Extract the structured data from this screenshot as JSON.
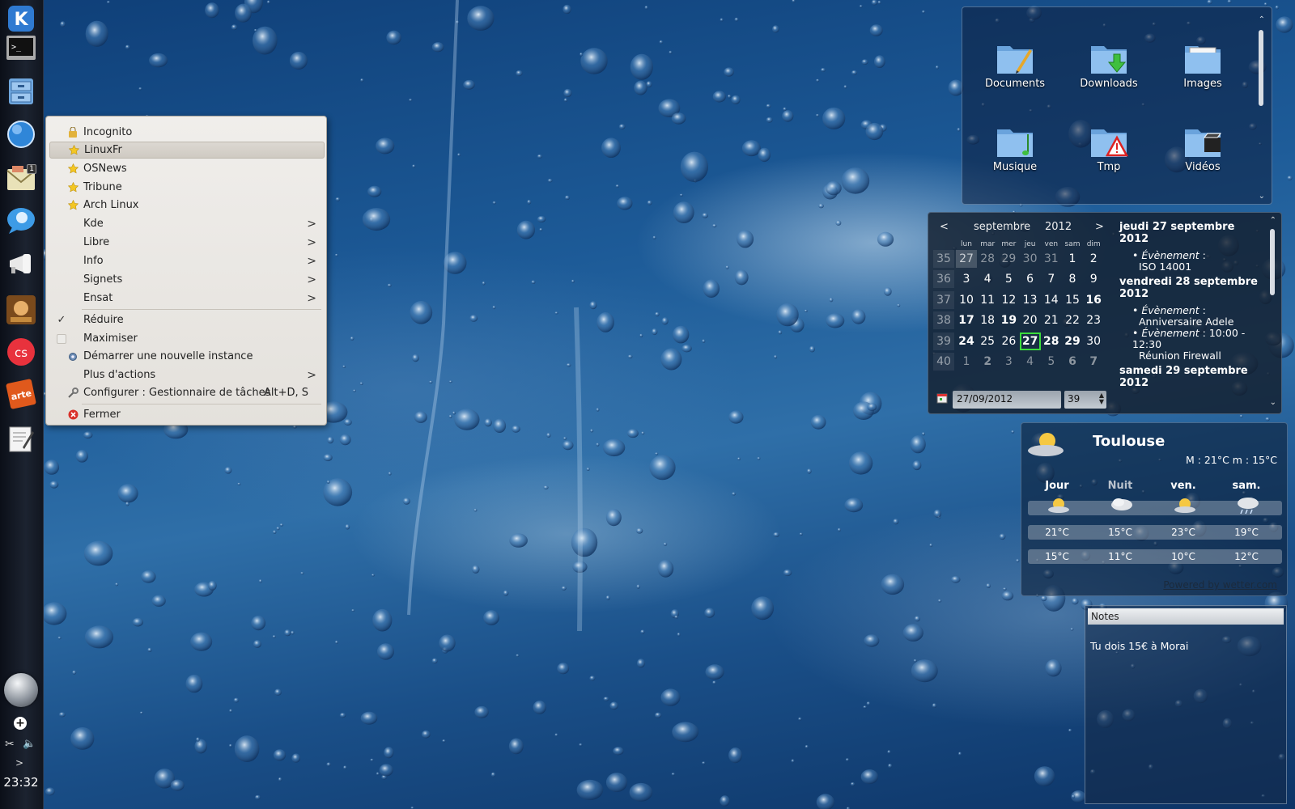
{
  "panel": {
    "clock": "23:32",
    "mail_badge": "1",
    "tray_more": ">"
  },
  "menu": {
    "items": [
      {
        "label": "Incognito",
        "icon": "lock-icon"
      },
      {
        "label": "LinuxFr",
        "icon": "star-icon",
        "selected": true
      },
      {
        "label": "OSNews",
        "icon": "star-icon"
      },
      {
        "label": "Tribune",
        "icon": "star-icon"
      },
      {
        "label": "Arch Linux",
        "icon": "star-icon"
      },
      {
        "label": "Kde",
        "submenu": true
      },
      {
        "label": "Libre",
        "submenu": true
      },
      {
        "label": "Info",
        "submenu": true
      },
      {
        "label": "Signets",
        "submenu": true
      },
      {
        "label": "Ensat",
        "submenu": true
      }
    ],
    "reduce": "Réduire",
    "maximize": "Maximiser",
    "new_instance": "Démarrer une nouvelle instance",
    "more_actions": "Plus d'actions",
    "configure": "Configurer : Gestionnaire de tâches",
    "configure_shortcut": "Alt+D, S",
    "close": "Fermer",
    "submenu_arrow": ">"
  },
  "folders": [
    {
      "label": "Documents",
      "icon": "folder-documents-icon"
    },
    {
      "label": "Downloads",
      "icon": "folder-downloads-icon"
    },
    {
      "label": "Images",
      "icon": "folder-images-icon"
    },
    {
      "label": "Musique",
      "icon": "folder-music-icon"
    },
    {
      "label": "Tmp",
      "icon": "folder-warning-icon"
    },
    {
      "label": "Vidéos",
      "icon": "folder-videos-icon"
    }
  ],
  "calendar": {
    "prev": "<",
    "next": ">",
    "month": "septembre",
    "year": "2012",
    "dow": [
      "lun",
      "mar",
      "mer",
      "jeu",
      "ven",
      "sam",
      "dim"
    ],
    "weeks": [
      "35",
      "36",
      "37",
      "38",
      "39",
      "40"
    ],
    "days": [
      [
        "27",
        "28",
        "29",
        "30",
        "31",
        "1",
        "2"
      ],
      [
        "3",
        "4",
        "5",
        "6",
        "7",
        "8",
        "9"
      ],
      [
        "10",
        "11",
        "12",
        "13",
        "14",
        "15",
        "16"
      ],
      [
        "17",
        "18",
        "19",
        "20",
        "21",
        "22",
        "23"
      ],
      [
        "24",
        "25",
        "26",
        "27",
        "28",
        "29",
        "30"
      ],
      [
        "1",
        "2",
        "3",
        "4",
        "5",
        "6",
        "7"
      ]
    ],
    "date_value": "27/09/2012",
    "week_value": "39",
    "events": {
      "day1": "jeudi 27 septembre 2012",
      "ev1_label": "Évènement",
      "ev1_sep": " :",
      "ev1_text": "ISO 14001",
      "day2": "vendredi 28 septembre 2012",
      "ev2_label": "Évènement",
      "ev2_sep": " :",
      "ev2_text": "Anniversaire Adele",
      "ev3_label": "Évènement",
      "ev3_sep": " : 10:00 - 12:30",
      "ev3_text": "Réunion Firewall",
      "day3": "samedi 29 septembre 2012"
    }
  },
  "weather": {
    "city": "Toulouse",
    "minmax": "M : 21°C m : 15°C",
    "columns": [
      "Jour",
      "Nuit",
      "ven.",
      "sam."
    ],
    "highs": [
      "21°C",
      "15°C",
      "23°C",
      "19°C"
    ],
    "lows": [
      "15°C",
      "11°C",
      "10°C",
      "12°C"
    ],
    "powered": "Powered by wetter.com"
  },
  "notes": {
    "title": "Notes",
    "text": "Tu dois 15€ à Morai"
  }
}
